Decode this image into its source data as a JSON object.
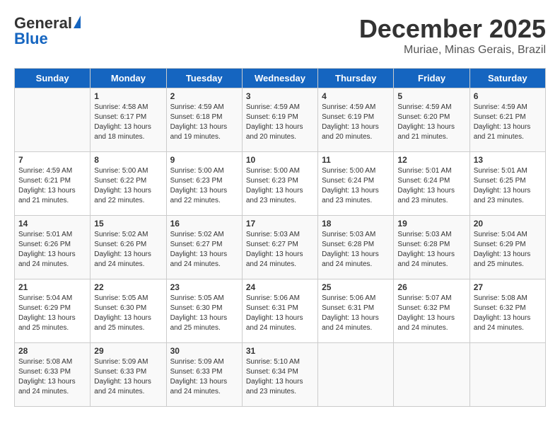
{
  "header": {
    "logo_general": "General",
    "logo_blue": "Blue",
    "month_year": "December 2025",
    "location": "Muriae, Minas Gerais, Brazil"
  },
  "calendar": {
    "days_of_week": [
      "Sunday",
      "Monday",
      "Tuesday",
      "Wednesday",
      "Thursday",
      "Friday",
      "Saturday"
    ],
    "weeks": [
      [
        {
          "day": "",
          "info": ""
        },
        {
          "day": "1",
          "info": "Sunrise: 4:58 AM\nSunset: 6:17 PM\nDaylight: 13 hours\nand 18 minutes."
        },
        {
          "day": "2",
          "info": "Sunrise: 4:59 AM\nSunset: 6:18 PM\nDaylight: 13 hours\nand 19 minutes."
        },
        {
          "day": "3",
          "info": "Sunrise: 4:59 AM\nSunset: 6:19 PM\nDaylight: 13 hours\nand 20 minutes."
        },
        {
          "day": "4",
          "info": "Sunrise: 4:59 AM\nSunset: 6:19 PM\nDaylight: 13 hours\nand 20 minutes."
        },
        {
          "day": "5",
          "info": "Sunrise: 4:59 AM\nSunset: 6:20 PM\nDaylight: 13 hours\nand 21 minutes."
        },
        {
          "day": "6",
          "info": "Sunrise: 4:59 AM\nSunset: 6:21 PM\nDaylight: 13 hours\nand 21 minutes."
        }
      ],
      [
        {
          "day": "7",
          "info": "Sunrise: 4:59 AM\nSunset: 6:21 PM\nDaylight: 13 hours\nand 21 minutes."
        },
        {
          "day": "8",
          "info": "Sunrise: 5:00 AM\nSunset: 6:22 PM\nDaylight: 13 hours\nand 22 minutes."
        },
        {
          "day": "9",
          "info": "Sunrise: 5:00 AM\nSunset: 6:23 PM\nDaylight: 13 hours\nand 22 minutes."
        },
        {
          "day": "10",
          "info": "Sunrise: 5:00 AM\nSunset: 6:23 PM\nDaylight: 13 hours\nand 23 minutes."
        },
        {
          "day": "11",
          "info": "Sunrise: 5:00 AM\nSunset: 6:24 PM\nDaylight: 13 hours\nand 23 minutes."
        },
        {
          "day": "12",
          "info": "Sunrise: 5:01 AM\nSunset: 6:24 PM\nDaylight: 13 hours\nand 23 minutes."
        },
        {
          "day": "13",
          "info": "Sunrise: 5:01 AM\nSunset: 6:25 PM\nDaylight: 13 hours\nand 23 minutes."
        }
      ],
      [
        {
          "day": "14",
          "info": "Sunrise: 5:01 AM\nSunset: 6:26 PM\nDaylight: 13 hours\nand 24 minutes."
        },
        {
          "day": "15",
          "info": "Sunrise: 5:02 AM\nSunset: 6:26 PM\nDaylight: 13 hours\nand 24 minutes."
        },
        {
          "day": "16",
          "info": "Sunrise: 5:02 AM\nSunset: 6:27 PM\nDaylight: 13 hours\nand 24 minutes."
        },
        {
          "day": "17",
          "info": "Sunrise: 5:03 AM\nSunset: 6:27 PM\nDaylight: 13 hours\nand 24 minutes."
        },
        {
          "day": "18",
          "info": "Sunrise: 5:03 AM\nSunset: 6:28 PM\nDaylight: 13 hours\nand 24 minutes."
        },
        {
          "day": "19",
          "info": "Sunrise: 5:03 AM\nSunset: 6:28 PM\nDaylight: 13 hours\nand 24 minutes."
        },
        {
          "day": "20",
          "info": "Sunrise: 5:04 AM\nSunset: 6:29 PM\nDaylight: 13 hours\nand 25 minutes."
        }
      ],
      [
        {
          "day": "21",
          "info": "Sunrise: 5:04 AM\nSunset: 6:29 PM\nDaylight: 13 hours\nand 25 minutes."
        },
        {
          "day": "22",
          "info": "Sunrise: 5:05 AM\nSunset: 6:30 PM\nDaylight: 13 hours\nand 25 minutes."
        },
        {
          "day": "23",
          "info": "Sunrise: 5:05 AM\nSunset: 6:30 PM\nDaylight: 13 hours\nand 25 minutes."
        },
        {
          "day": "24",
          "info": "Sunrise: 5:06 AM\nSunset: 6:31 PM\nDaylight: 13 hours\nand 24 minutes."
        },
        {
          "day": "25",
          "info": "Sunrise: 5:06 AM\nSunset: 6:31 PM\nDaylight: 13 hours\nand 24 minutes."
        },
        {
          "day": "26",
          "info": "Sunrise: 5:07 AM\nSunset: 6:32 PM\nDaylight: 13 hours\nand 24 minutes."
        },
        {
          "day": "27",
          "info": "Sunrise: 5:08 AM\nSunset: 6:32 PM\nDaylight: 13 hours\nand 24 minutes."
        }
      ],
      [
        {
          "day": "28",
          "info": "Sunrise: 5:08 AM\nSunset: 6:33 PM\nDaylight: 13 hours\nand 24 minutes."
        },
        {
          "day": "29",
          "info": "Sunrise: 5:09 AM\nSunset: 6:33 PM\nDaylight: 13 hours\nand 24 minutes."
        },
        {
          "day": "30",
          "info": "Sunrise: 5:09 AM\nSunset: 6:33 PM\nDaylight: 13 hours\nand 24 minutes."
        },
        {
          "day": "31",
          "info": "Sunrise: 5:10 AM\nSunset: 6:34 PM\nDaylight: 13 hours\nand 23 minutes."
        },
        {
          "day": "",
          "info": ""
        },
        {
          "day": "",
          "info": ""
        },
        {
          "day": "",
          "info": ""
        }
      ]
    ]
  }
}
